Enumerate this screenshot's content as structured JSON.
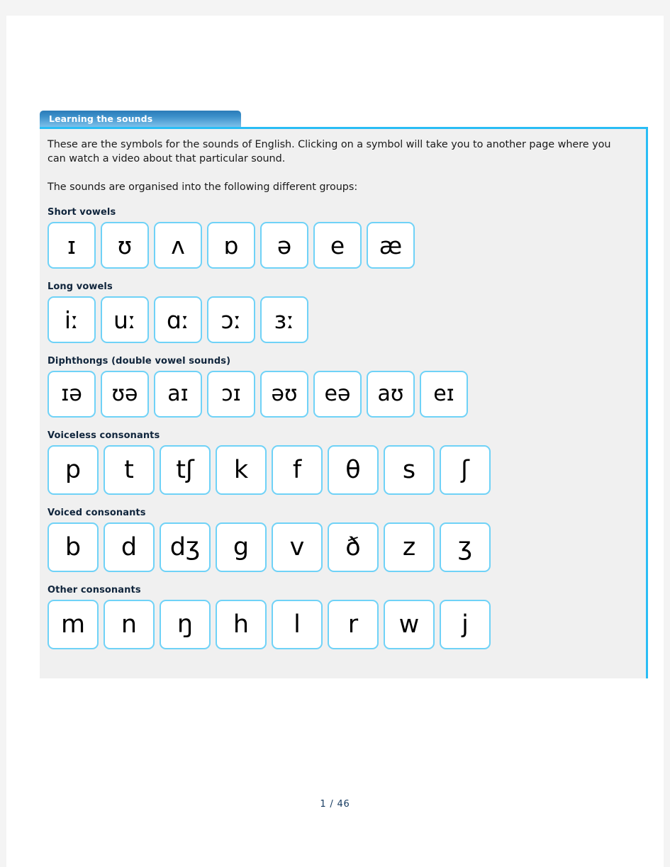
{
  "panel": {
    "tab_title": "Learning the sounds",
    "intro_paragraph_1": "These are the symbols for the sounds of English. Clicking on a symbol will take you to another page where you can watch a video about that particular sound.",
    "intro_paragraph_2": "The sounds are organised into the following different groups:",
    "accent_color": "#29bdf5",
    "box_border_color": "#6fd2f7",
    "panel_background": "#f0f0f0",
    "tab_text_color": "#ffffff"
  },
  "groups": [
    {
      "label": "Short vowels",
      "symbols": [
        "ɪ",
        "ʊ",
        "ʌ",
        "ɒ",
        "ə",
        "e",
        "æ"
      ]
    },
    {
      "label": "Long vowels",
      "symbols": [
        "iː",
        "uː",
        "ɑː",
        "ɔː",
        "ɜː"
      ]
    },
    {
      "label": "Diphthongs (double vowel sounds)",
      "symbols": [
        "ɪə",
        "ʊə",
        "aɪ",
        "ɔɪ",
        "əʊ",
        "eə",
        "aʊ",
        "eɪ"
      ]
    },
    {
      "label": "Voiceless consonants",
      "symbols": [
        "p",
        "t",
        "tʃ",
        "k",
        "f",
        "θ",
        "s",
        "ʃ"
      ]
    },
    {
      "label": "Voiced consonants",
      "symbols": [
        "b",
        "d",
        "dʒ",
        "g",
        "v",
        "ð",
        "z",
        "ʒ"
      ]
    },
    {
      "label": "Other consonants",
      "symbols": [
        "m",
        "n",
        "ŋ",
        "h",
        "l",
        "r",
        "w",
        "j"
      ]
    }
  ],
  "footer": {
    "page_indicator": "1 / 46"
  }
}
